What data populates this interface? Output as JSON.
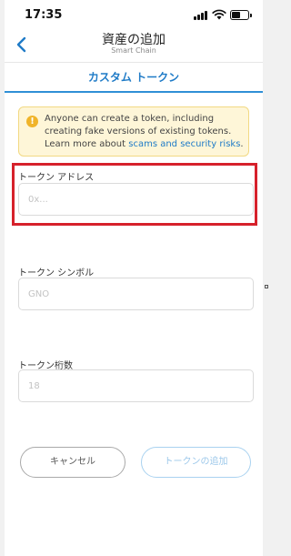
{
  "status_bar": {
    "time": "17:35"
  },
  "nav": {
    "title": "資産の追加",
    "subtitle": "Smart Chain"
  },
  "tab": {
    "label": "カスタム トークン"
  },
  "alert": {
    "text_before_link": "Anyone can create a token, including creating fake versions of existing tokens. Learn more about ",
    "link_text": "scams and security risks",
    "text_after_link": "."
  },
  "fields": {
    "address": {
      "label": "トークン アドレス",
      "placeholder": "0x..."
    },
    "symbol": {
      "label": "トークン シンボル",
      "placeholder": "GNO"
    },
    "decimals": {
      "label": "トークン桁数",
      "placeholder": "18"
    }
  },
  "buttons": {
    "cancel": "キャンセル",
    "add": "トークンの追加"
  },
  "colors": {
    "accent": "#1f7bc7",
    "highlight": "#d6212b",
    "warning_bg": "#fef6d8",
    "warning_icon": "#f0b429"
  }
}
